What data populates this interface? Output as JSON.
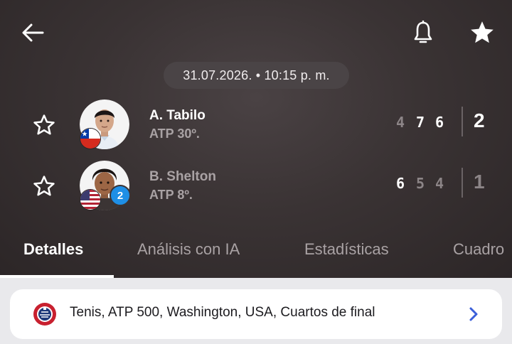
{
  "header": {
    "back_icon": "arrow-left-icon",
    "bell_icon": "bell-icon",
    "favorite_icon": "star-filled-icon"
  },
  "match": {
    "datetime": "31.07.2026. • 10:15 p. m."
  },
  "players": [
    {
      "name": "A. Tabilo",
      "rank": "ATP 30º.",
      "flag": "chile-flag",
      "sets": [
        "4",
        "7",
        "6"
      ],
      "total": "2",
      "star_icon": "star-outline-icon"
    },
    {
      "name": "B. Shelton",
      "rank": "ATP 8º.",
      "flag": "usa-flag",
      "seed": "2",
      "sets": [
        "6",
        "5",
        "4"
      ],
      "total": "1",
      "star_icon": "star-outline-icon"
    }
  ],
  "tabs": [
    {
      "label": "Detalles",
      "active": true
    },
    {
      "label": "Análisis con IA",
      "active": false
    },
    {
      "label": "Estadísticas",
      "active": false
    },
    {
      "label": "Cuadro",
      "active": false
    }
  ],
  "tournament": {
    "label": "Tenis, ATP 500, Washington, USA, Cuartos de final",
    "chevron_icon": "chevron-right-icon"
  },
  "colors": {
    "accent_blue": "#1e8fe6",
    "chevron_blue": "#3b5fd9"
  }
}
